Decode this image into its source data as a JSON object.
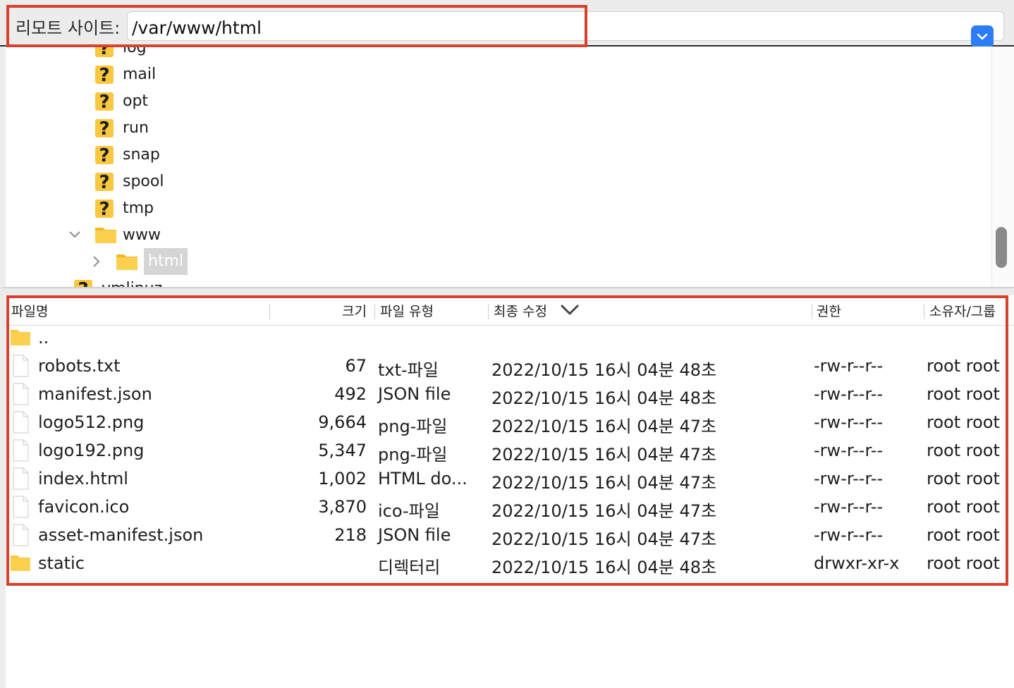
{
  "site_bar": {
    "label": "리모트 사이트:",
    "path": "/var/www/html"
  },
  "tree": {
    "items": [
      {
        "label": "log",
        "icon": "unknown-folder-icon"
      },
      {
        "label": "mail",
        "icon": "unknown-folder-icon"
      },
      {
        "label": "opt",
        "icon": "unknown-folder-icon"
      },
      {
        "label": "run",
        "icon": "unknown-folder-icon"
      },
      {
        "label": "snap",
        "icon": "unknown-folder-icon"
      },
      {
        "label": "spool",
        "icon": "unknown-folder-icon"
      },
      {
        "label": "tmp",
        "icon": "unknown-folder-icon"
      },
      {
        "label": "www",
        "icon": "folder-icon",
        "expanded": true
      },
      {
        "label": "html",
        "icon": "folder-icon",
        "selected": true
      },
      {
        "label": "vmlinuz",
        "icon": "unknown-folder-icon"
      }
    ]
  },
  "list": {
    "columns": {
      "name": "파일명",
      "size": "크기",
      "type": "파일 유형",
      "modified": "최종 수정",
      "permissions": "권한",
      "owner": "소유자/그룹"
    },
    "sort_column": "modified",
    "sort_direction": "descending",
    "parent": "..",
    "rows": [
      {
        "name": "robots.txt",
        "size": "67",
        "type": "txt-파일",
        "modified": "2022/10/15 16시 04분 48초",
        "permissions": "-rw-r--r--",
        "owner": "root root",
        "kind": "file"
      },
      {
        "name": "manifest.json",
        "size": "492",
        "type": "JSON file",
        "modified": "2022/10/15 16시 04분 48초",
        "permissions": "-rw-r--r--",
        "owner": "root root",
        "kind": "file"
      },
      {
        "name": "logo512.png",
        "size": "9,664",
        "type": "png-파일",
        "modified": "2022/10/15 16시 04분 47초",
        "permissions": "-rw-r--r--",
        "owner": "root root",
        "kind": "file"
      },
      {
        "name": "logo192.png",
        "size": "5,347",
        "type": "png-파일",
        "modified": "2022/10/15 16시 04분 47초",
        "permissions": "-rw-r--r--",
        "owner": "root root",
        "kind": "file"
      },
      {
        "name": "index.html",
        "size": "1,002",
        "type": "HTML do...",
        "modified": "2022/10/15 16시 04분 47초",
        "permissions": "-rw-r--r--",
        "owner": "root root",
        "kind": "file"
      },
      {
        "name": "favicon.ico",
        "size": "3,870",
        "type": "ico-파일",
        "modified": "2022/10/15 16시 04분 47초",
        "permissions": "-rw-r--r--",
        "owner": "root root",
        "kind": "file"
      },
      {
        "name": "asset-manifest.json",
        "size": "218",
        "type": "JSON file",
        "modified": "2022/10/15 16시 04분 47초",
        "permissions": "-rw-r--r--",
        "owner": "root root",
        "kind": "file"
      },
      {
        "name": "static",
        "size": "",
        "type": "디렉터리",
        "modified": "2022/10/15 16시 04분 48초",
        "permissions": "drwxr-xr-x",
        "owner": "root root",
        "kind": "folder"
      }
    ]
  },
  "colors": {
    "highlight": "#d9412d",
    "accent": "#2e7cf6",
    "folder": "#f9c840"
  }
}
